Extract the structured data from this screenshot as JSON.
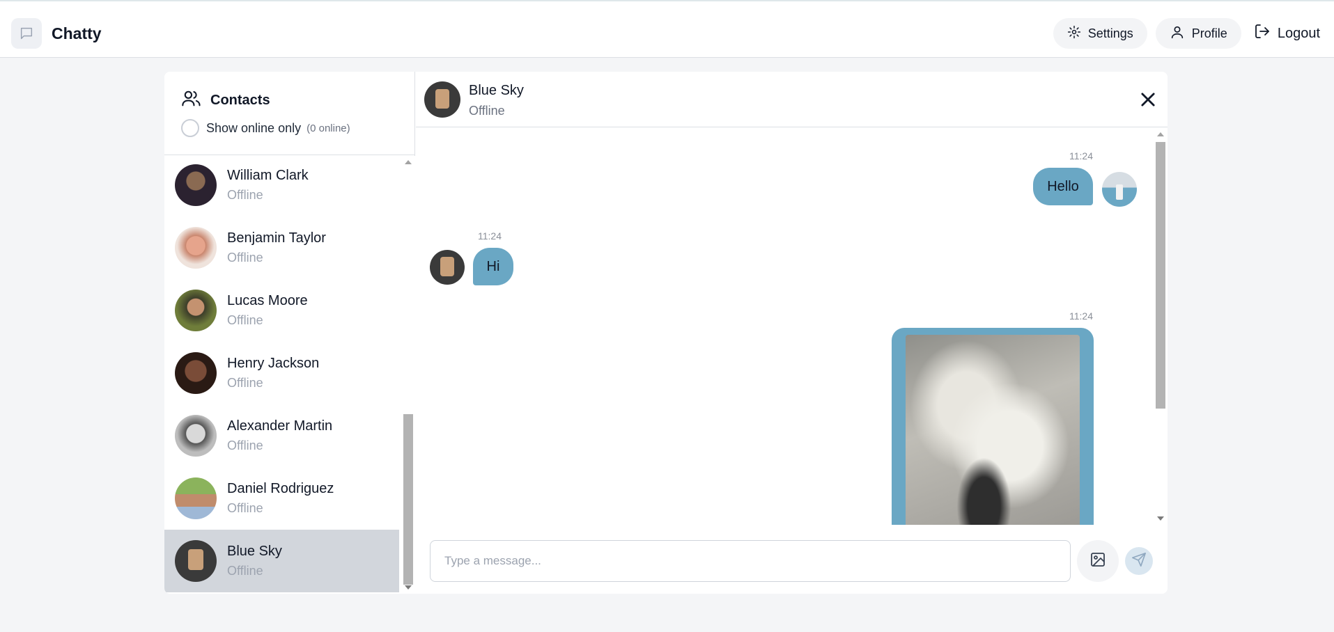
{
  "app": {
    "name": "Chatty"
  },
  "nav": {
    "settings_label": "Settings",
    "profile_label": "Profile",
    "logout_label": "Logout"
  },
  "sidebar": {
    "title": "Contacts",
    "filter_label": "Show online only",
    "online_count": "(0 online)",
    "contacts": [
      {
        "name": "William Clark",
        "status": "Offline"
      },
      {
        "name": "Benjamin Taylor",
        "status": "Offline"
      },
      {
        "name": "Lucas Moore",
        "status": "Offline"
      },
      {
        "name": "Henry Jackson",
        "status": "Offline"
      },
      {
        "name": "Alexander Martin",
        "status": "Offline"
      },
      {
        "name": "Daniel Rodriguez",
        "status": "Offline"
      },
      {
        "name": "Blue Sky",
        "status": "Offline"
      }
    ]
  },
  "chat": {
    "name": "Blue Sky",
    "status": "Offline",
    "messages": [
      {
        "time": "11:24",
        "text": "Hello",
        "from": "me"
      },
      {
        "time": "11:24",
        "text": "Hi",
        "from": "them"
      },
      {
        "time": "11:24",
        "text": "",
        "from": "me",
        "kind": "image"
      }
    ],
    "input_placeholder": "Type a message..."
  },
  "colors": {
    "bubble": "#6aa7c4",
    "active_contact": "#d2d6dc",
    "page_bg": "#f4f5f7"
  },
  "icons": [
    "message-square-icon",
    "gear-icon",
    "user-icon",
    "logout-icon",
    "users-icon",
    "close-icon",
    "image-icon",
    "send-icon"
  ]
}
